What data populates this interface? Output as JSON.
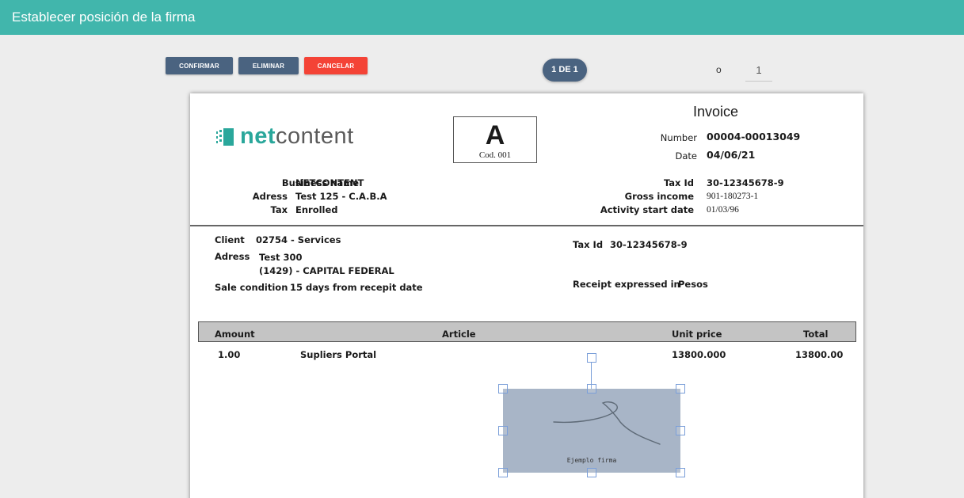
{
  "header": {
    "title": "Establecer posición de la firma"
  },
  "toolbar": {
    "confirm": "CONFIRMAR",
    "delete": "ELIMINAR",
    "cancel": "CANCELAR"
  },
  "pager": {
    "indicator": "1 DE 1",
    "or": "o",
    "page_value": "1"
  },
  "invoice": {
    "logo_net": "net",
    "logo_content": "content",
    "type_letter": "A",
    "type_code": "Cod.   001",
    "title": "Invoice",
    "number_label": "Number",
    "number_value": "00004-00013049",
    "date_label": "Date",
    "date_value": "04/06/21",
    "business_name_label": "Business name",
    "business_name_value": "NETCONTENT",
    "adress_label": "Adress",
    "adress_value": "Test 125 - C.A.B.A",
    "tax_label": "Tax",
    "tax_value": "Enrolled",
    "taxid_label": "Tax Id",
    "taxid_value": "30-12345678-9",
    "gross_label": "Gross income",
    "gross_value": "901-180273-1",
    "activity_label": "Activity start date",
    "activity_value": "01/03/96",
    "client_label": "Client",
    "client_value": "02754  -  Services",
    "client_adress_label": "Adress",
    "client_adress_line1": "Test 300",
    "client_adress_line2": "(1429) - CAPITAL FEDERAL",
    "sale_label": "Sale condition",
    "sale_value": "15 days from recepit date",
    "client_taxid_label": "Tax Id",
    "client_taxid_value": "30-12345678-9",
    "receipt_label": "Receipt expressed in",
    "receipt_value": "Pesos",
    "columns": {
      "amount": "Amount",
      "article": "Article",
      "unit_price": "Unit price",
      "total": "Total"
    },
    "row": {
      "amount": "1.00",
      "article": "Supliers Portal",
      "unit_price": "13800.000",
      "total": "13800.00"
    }
  },
  "signature": {
    "caption": "Ejemplo firma"
  },
  "colors": {
    "header": "#41b6ac",
    "primary_button": "#4a6380",
    "cancel_button": "#f44336",
    "signature_fill": "#a8b5c7",
    "handle": "#7b9fd9"
  }
}
